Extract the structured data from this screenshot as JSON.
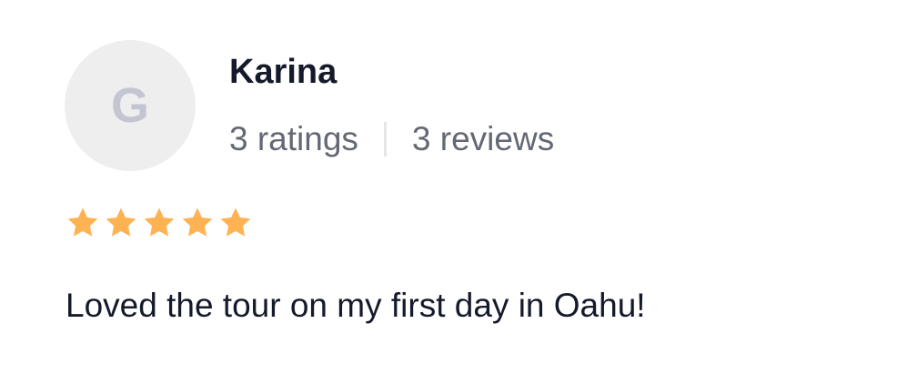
{
  "review": {
    "avatar_initial": "G",
    "user_name": "Karina",
    "ratings_count": "3 ratings",
    "reviews_count": "3 reviews",
    "rating": 5,
    "rating_max": 5,
    "text": "Loved the tour on my first day in Oahu!"
  },
  "colors": {
    "star": "#ffb252",
    "name_text": "#151a2b",
    "secondary_text": "#636875",
    "avatar_bg": "#eeeeef",
    "avatar_letter": "#c3c6d1",
    "divider": "#e5e6ea"
  },
  "icons": {
    "star": "star-icon"
  }
}
